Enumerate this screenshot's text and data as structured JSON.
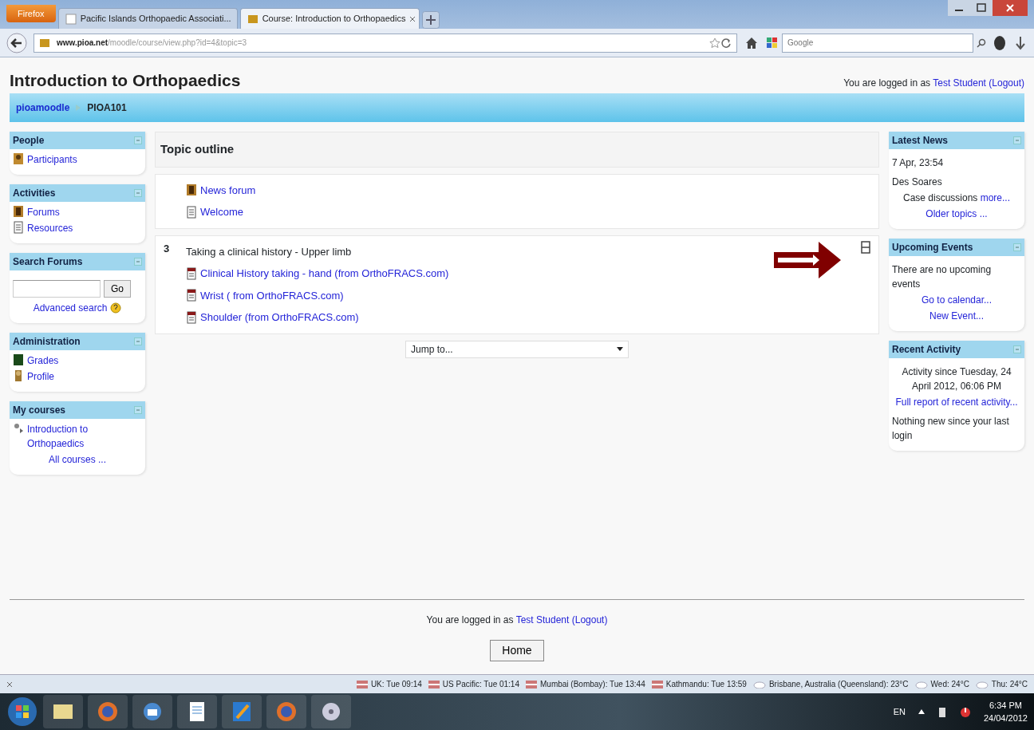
{
  "browser": {
    "menu_button": "Firefox",
    "tabs": [
      {
        "title": "Pacific Islands Orthopaedic Associati...",
        "selected": false
      },
      {
        "title": "Course: Introduction to Orthopaedics",
        "selected": true
      }
    ],
    "url_host": "www.pioa.net",
    "url_path": "/moodle/course/view.php?id=4&topic=3",
    "search_placeholder": "Google"
  },
  "page": {
    "title": "Introduction to Orthopaedics",
    "login": {
      "prefix": "You are logged in as",
      "user": "Test Student",
      "logout": "(Logout)"
    },
    "breadcrumb": [
      "pioamoodle",
      "PIOA101"
    ],
    "left_blocks": [
      {
        "title": "People",
        "lines": [
          {
            "kind": "people",
            "text": "Participants"
          }
        ]
      },
      {
        "title": "Activities",
        "lines": [
          {
            "kind": "forum",
            "text": "Forums"
          },
          {
            "kind": "resource",
            "text": "Resources"
          }
        ]
      },
      {
        "title": "Search Forums",
        "lines": [
          {
            "kind": "search",
            "button": "Go",
            "link": "Advanced search"
          }
        ]
      },
      {
        "title": "Administration",
        "lines": [
          {
            "kind": "grades",
            "text": "Grades"
          },
          {
            "kind": "profile",
            "text": "Profile"
          }
        ]
      },
      {
        "title": "My courses",
        "lines": [
          {
            "kind": "course",
            "text": "Introduction to Orthopaedics"
          },
          {
            "kind": "link_center",
            "text": "All courses ..."
          }
        ]
      }
    ],
    "outline_title": "Topic outline",
    "sections": [
      {
        "items": [
          {
            "kind": "forum",
            "text": "News forum"
          },
          {
            "kind": "page",
            "text": "Welcome"
          }
        ]
      },
      {
        "number": "3",
        "title": "Taking a clinical history - Upper limb",
        "items": [
          {
            "kind": "pdf",
            "text": "Clinical History taking - hand (from OrthoFRACS.com)"
          },
          {
            "kind": "pdf",
            "text": "Wrist ( from OrthoFRACS.com)"
          },
          {
            "kind": "pdf",
            "text": "Shoulder (from OrthoFRACS.com)"
          }
        ]
      }
    ],
    "jump_to": "Jump to...",
    "right_blocks": [
      {
        "title": "Latest News",
        "lines": [
          {
            "kind": "text",
            "text": "7 Apr, 23:54"
          },
          {
            "kind": "text",
            "text": "Des Soares"
          },
          {
            "kind": "text_link_center",
            "text": "Case discussions",
            "link": "more..."
          },
          {
            "kind": "link_center",
            "text": "Older topics ..."
          }
        ]
      },
      {
        "title": "Upcoming Events",
        "lines": [
          {
            "kind": "text",
            "text": "There are no upcoming events"
          },
          {
            "kind": "link_center",
            "text": "Go to calendar..."
          },
          {
            "kind": "link_center",
            "text": "New Event..."
          }
        ]
      },
      {
        "title": "Recent Activity",
        "lines": [
          {
            "kind": "text_center",
            "text": "Activity since Tuesday, 24 April 2012, 06:06 PM"
          },
          {
            "kind": "link_center",
            "text": "Full report of recent activity..."
          },
          {
            "kind": "text",
            "text": "Nothing new since your last login"
          }
        ]
      }
    ],
    "footer_login": {
      "prefix": "You are logged in as",
      "user": "Test Student",
      "logout": "(Logout)"
    },
    "home_button": "Home"
  },
  "status_bar": [
    {
      "kind": "flag",
      "text": "UK: Tue 09:14"
    },
    {
      "kind": "flag",
      "text": "US Pacific: Tue 01:14"
    },
    {
      "kind": "flag",
      "text": "Mumbai (Bombay): Tue 13:44"
    },
    {
      "kind": "flag",
      "text": "Kathmandu: Tue 13:59"
    },
    {
      "kind": "weather",
      "text": "Brisbane, Australia (Queensland): 23°C"
    },
    {
      "kind": "weather",
      "text": "Wed: 24°C"
    },
    {
      "kind": "weather",
      "text": "Thu: 24°C"
    }
  ],
  "taskbar": {
    "language": "EN",
    "time": "6:34 PM",
    "date": "24/04/2012"
  }
}
